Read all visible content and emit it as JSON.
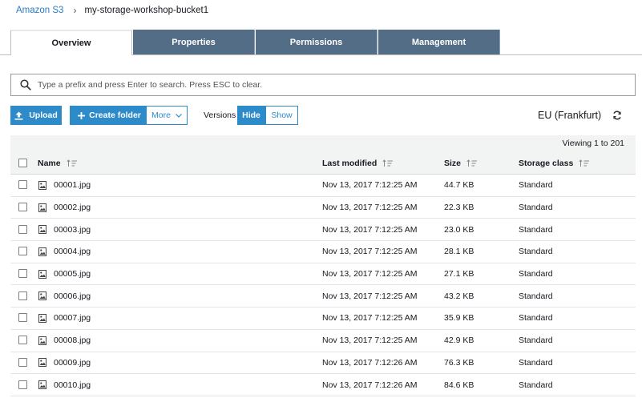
{
  "breadcrumb": {
    "root": "Amazon S3",
    "separator": "›",
    "bucket": "my-storage-workshop-bucket1"
  },
  "tabs": [
    {
      "label": "Overview",
      "active": true
    },
    {
      "label": "Properties",
      "active": false
    },
    {
      "label": "Permissions",
      "active": false
    },
    {
      "label": "Management",
      "active": false
    }
  ],
  "search": {
    "placeholder": "Type a prefix and press Enter to search. Press ESC to clear.",
    "value": ""
  },
  "toolbar": {
    "upload_label": "Upload",
    "create_folder_label": "Create folder",
    "more_label": "More",
    "versions_label": "Versions",
    "hide_label": "Hide",
    "show_label": "Show",
    "region": "EU (Frankfurt)"
  },
  "viewing": "Viewing 1 to 201",
  "table": {
    "columns": {
      "name": "Name",
      "last_modified": "Last modified",
      "size": "Size",
      "storage_class": "Storage class"
    },
    "rows": [
      {
        "name": "00001.jpg",
        "modified": "Nov 13, 2017 7:12:25 AM",
        "size": "44.7 KB",
        "class": "Standard"
      },
      {
        "name": "00002.jpg",
        "modified": "Nov 13, 2017 7:12:25 AM",
        "size": "22.3 KB",
        "class": "Standard"
      },
      {
        "name": "00003.jpg",
        "modified": "Nov 13, 2017 7:12:25 AM",
        "size": "23.0 KB",
        "class": "Standard"
      },
      {
        "name": "00004.jpg",
        "modified": "Nov 13, 2017 7:12:25 AM",
        "size": "28.1 KB",
        "class": "Standard"
      },
      {
        "name": "00005.jpg",
        "modified": "Nov 13, 2017 7:12:25 AM",
        "size": "27.1 KB",
        "class": "Standard"
      },
      {
        "name": "00006.jpg",
        "modified": "Nov 13, 2017 7:12:25 AM",
        "size": "43.2 KB",
        "class": "Standard"
      },
      {
        "name": "00007.jpg",
        "modified": "Nov 13, 2017 7:12:25 AM",
        "size": "35.9 KB",
        "class": "Standard"
      },
      {
        "name": "00008.jpg",
        "modified": "Nov 13, 2017 7:12:25 AM",
        "size": "42.9 KB",
        "class": "Standard"
      },
      {
        "name": "00009.jpg",
        "modified": "Nov 13, 2017 7:12:26 AM",
        "size": "76.3 KB",
        "class": "Standard"
      },
      {
        "name": "00010.jpg",
        "modified": "Nov 13, 2017 7:12:26 AM",
        "size": "84.6 KB",
        "class": "Standard"
      }
    ]
  },
  "colors": {
    "accent_blue": "#2e8bc9",
    "tab_dark": "#546d86",
    "link": "#2b7bc0"
  },
  "icons": [
    "search-icon",
    "upload-icon",
    "plus-icon",
    "chevron-down-icon",
    "refresh-icon",
    "sort-icon",
    "image-file-icon"
  ]
}
